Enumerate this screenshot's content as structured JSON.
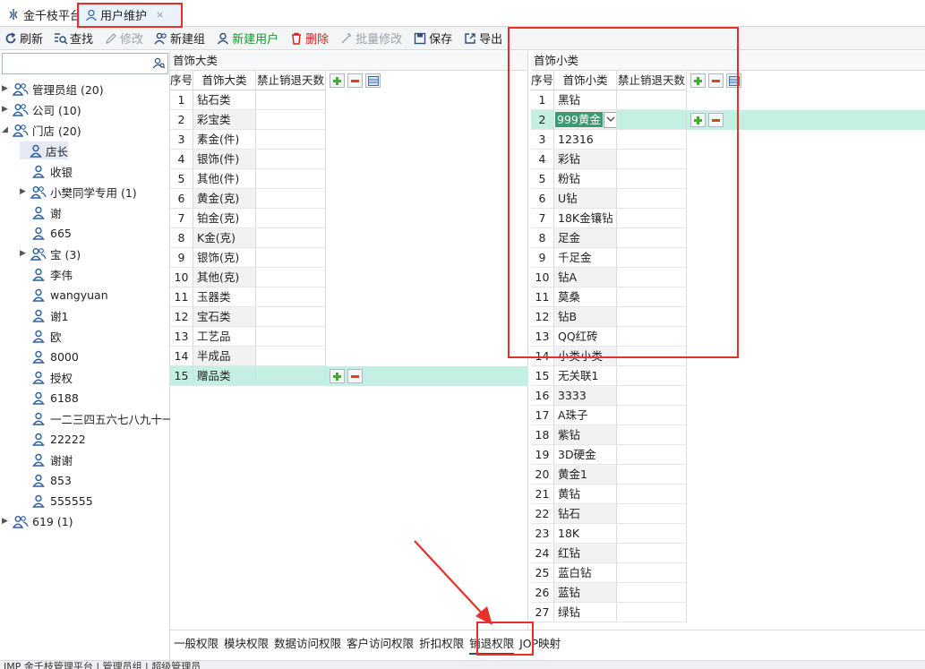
{
  "tabs": [
    {
      "label": "金千枝平台"
    },
    {
      "label": "用户维护",
      "close": "×"
    }
  ],
  "toolbar": {
    "refresh": "刷新",
    "find": "查找",
    "edit": "修改",
    "new_group": "新建组",
    "new_user": "新建用户",
    "delete": "删除",
    "batch_edit": "批量修改",
    "save": "保存",
    "export": "导出"
  },
  "search": {
    "value": "",
    "placeholder": ""
  },
  "tree": [
    {
      "label": "管理员组 (20)",
      "type": "group",
      "expand": "▶"
    },
    {
      "label": "公司 (10)",
      "type": "group",
      "expand": "▶"
    },
    {
      "label": "门店 (20)",
      "type": "group",
      "expand": "◢"
    },
    {
      "label": "店长",
      "type": "user"
    },
    {
      "label": "收银",
      "type": "user"
    },
    {
      "label": "小樊同学专用 (1)",
      "type": "group",
      "expand": "▶"
    },
    {
      "label": "谢",
      "type": "user"
    },
    {
      "label": "665",
      "type": "user"
    },
    {
      "label": "宝 (3)",
      "type": "group",
      "expand": "▶"
    },
    {
      "label": "李伟",
      "type": "user"
    },
    {
      "label": "wangyuan",
      "type": "user"
    },
    {
      "label": "谢1",
      "type": "user"
    },
    {
      "label": "欧",
      "type": "user"
    },
    {
      "label": "8000",
      "type": "user"
    },
    {
      "label": "授权",
      "type": "user"
    },
    {
      "label": "6188",
      "type": "user"
    },
    {
      "label": "一二三四五六七八九十一二",
      "type": "user"
    },
    {
      "label": "22222",
      "type": "user"
    },
    {
      "label": "谢谢",
      "type": "user"
    },
    {
      "label": "853",
      "type": "user"
    },
    {
      "label": "555555",
      "type": "user"
    },
    {
      "label": "619 (1)",
      "type": "group",
      "expand": "▶"
    }
  ],
  "left_grid": {
    "title": "首饰大类",
    "headers": [
      "序号",
      "首饰大类",
      "禁止销退天数"
    ],
    "rows": [
      [
        "1",
        "钻石类",
        ""
      ],
      [
        "2",
        "彩宝类",
        ""
      ],
      [
        "3",
        "素金(件)",
        ""
      ],
      [
        "4",
        "银饰(件)",
        ""
      ],
      [
        "5",
        "其他(件)",
        ""
      ],
      [
        "6",
        "黄金(克)",
        ""
      ],
      [
        "7",
        "铂金(克)",
        ""
      ],
      [
        "8",
        "K金(克)",
        ""
      ],
      [
        "9",
        "银饰(克)",
        ""
      ],
      [
        "10",
        "其他(克)",
        ""
      ],
      [
        "11",
        "玉器类",
        ""
      ],
      [
        "12",
        "宝石类",
        ""
      ],
      [
        "13",
        "工艺品",
        ""
      ],
      [
        "14",
        "半成品",
        ""
      ],
      [
        "15",
        "赠品类",
        ""
      ]
    ]
  },
  "right_grid": {
    "title": "首饰小类",
    "headers": [
      "序号",
      "首饰小类",
      "禁止销退天数"
    ],
    "rows": [
      [
        "1",
        "黑钻",
        ""
      ],
      [
        "2",
        "999黄金",
        ""
      ],
      [
        "3",
        "12316",
        ""
      ],
      [
        "4",
        "彩钻",
        ""
      ],
      [
        "5",
        "粉钻",
        ""
      ],
      [
        "6",
        "U钻",
        ""
      ],
      [
        "7",
        "18K金镶钻",
        ""
      ],
      [
        "8",
        "足金",
        ""
      ],
      [
        "9",
        "千足金",
        ""
      ],
      [
        "10",
        "钻A",
        ""
      ],
      [
        "11",
        "莫桑",
        ""
      ],
      [
        "12",
        "钻B",
        ""
      ],
      [
        "13",
        "QQ红砖",
        ""
      ],
      [
        "14",
        "小类小类",
        ""
      ],
      [
        "15",
        "无关联1",
        ""
      ],
      [
        "16",
        "3333",
        ""
      ],
      [
        "17",
        "A珠子",
        ""
      ],
      [
        "18",
        "紫钻",
        ""
      ],
      [
        "19",
        "3D硬金",
        ""
      ],
      [
        "20",
        "黄金1",
        ""
      ],
      [
        "21",
        "黄钻",
        ""
      ],
      [
        "22",
        "钻石",
        ""
      ],
      [
        "23",
        "18K",
        ""
      ],
      [
        "24",
        "红钻",
        ""
      ],
      [
        "25",
        "蓝白钻",
        ""
      ],
      [
        "26",
        "蓝钻",
        ""
      ],
      [
        "27",
        "绿钻",
        ""
      ]
    ]
  },
  "bottom_tabs": [
    "一般权限",
    "模块权限",
    "数据访问权限",
    "客户访问权限",
    "折扣权限",
    "销退权限",
    "JOP映射"
  ],
  "status": "JMP   金千枝管理平台  |  管理员组  |  超级管理员",
  "colors": {
    "accent": "#2b4f7e",
    "highlight_row": "#c4f0e4",
    "annotation": "#e8302a"
  }
}
